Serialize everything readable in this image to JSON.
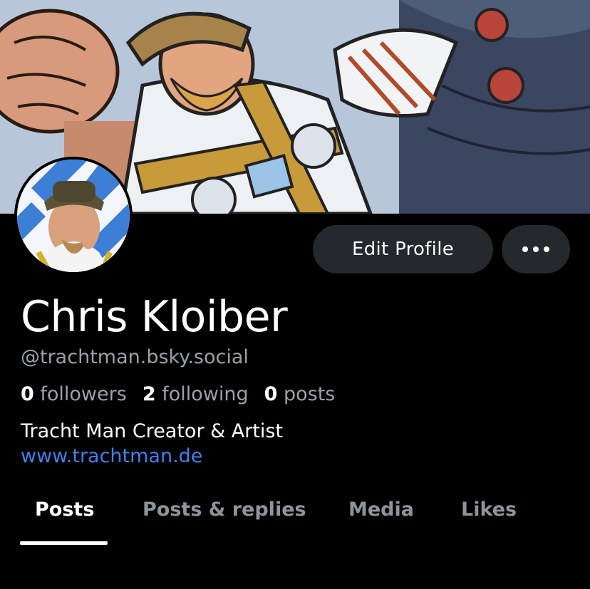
{
  "profile": {
    "display_name": "Chris Kloiber",
    "handle": "@trachtman.bsky.social",
    "stats": {
      "followers_count": "0",
      "followers_label": "followers",
      "following_count": "2",
      "following_label": "following",
      "posts_count": "0",
      "posts_label": "posts"
    },
    "bio": "Tracht Man Creator & Artist",
    "website": "www.trachtman.de"
  },
  "actions": {
    "edit_label": "Edit Profile",
    "more_icon": "ellipsis-icon"
  },
  "tabs": [
    {
      "label": "Posts",
      "active": true
    },
    {
      "label": "Posts & replies",
      "active": false
    },
    {
      "label": "Media",
      "active": false
    },
    {
      "label": "Likes",
      "active": false
    }
  ],
  "colors": {
    "background": "#000000",
    "button_bg": "#25282c",
    "link": "#3b82f0",
    "muted_text": "#9aa1a9"
  }
}
